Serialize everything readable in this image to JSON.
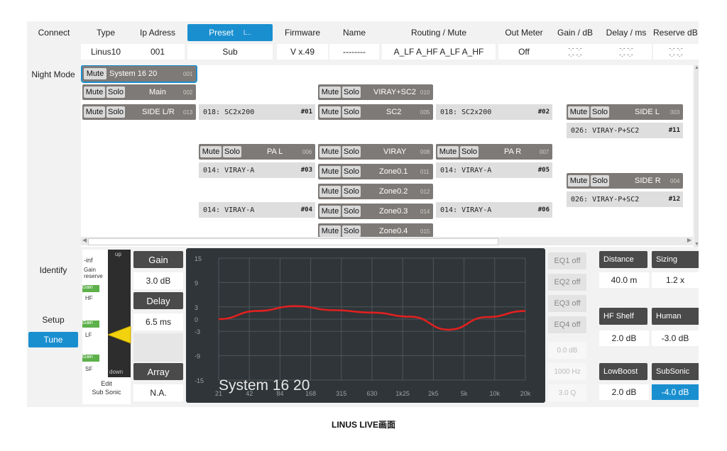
{
  "header": {
    "connect": "Connect",
    "type": "Type",
    "ip": "Ip Adress",
    "preset": "Preset",
    "preset_suffix": "L..",
    "firmware": "Firmware",
    "name": "Name",
    "routing": "Routing / Mute",
    "out_meter": "Out Meter",
    "gain": "Gain / dB",
    "delay": "Delay / ms",
    "reserve": "Reserve dB"
  },
  "device": {
    "type": "Linus10",
    "ip": "001",
    "preset": "Sub",
    "firmware": "V x.49",
    "name": "--------",
    "routing": "A_LF  A_HF  A_LF  A_HF",
    "out_meter": "Off",
    "dash": "-.-  -.-"
  },
  "sidebar": {
    "night_mode": "Night Mode",
    "identify": "Identify",
    "setup": "Setup",
    "tune": "Tune"
  },
  "patch": {
    "mute": "Mute",
    "solo": "Solo",
    "groups": {
      "system": {
        "name": "System 16 20",
        "num": "001"
      },
      "main": {
        "name": "Main",
        "num": "002"
      },
      "side_lr": {
        "name": "SIDE L/R",
        "num": "013"
      },
      "viray_sc2": {
        "name": "VIRAY+SC2",
        "num": "010"
      },
      "sc2": {
        "name": "SC2",
        "num": "005"
      },
      "side_l": {
        "name": "SIDE L",
        "num": "003"
      },
      "pal": {
        "name": "PA L",
        "num": "006"
      },
      "viray": {
        "name": "VIRAY",
        "num": "008"
      },
      "par": {
        "name": "PA R",
        "num": "007"
      },
      "zone1": {
        "name": "Zone0.1",
        "num": "011"
      },
      "zone2": {
        "name": "Zone0.2",
        "num": "012"
      },
      "zone3": {
        "name": "Zone0.3",
        "num": "014"
      },
      "zone4": {
        "name": "Zone0.4",
        "num": "015"
      },
      "side_r": {
        "name": "SIDE R",
        "num": "004"
      }
    },
    "subs": {
      "s01": {
        "name": "018: SC2x200",
        "num": "#01"
      },
      "s02": {
        "name": "018: SC2x200",
        "num": "#02"
      },
      "s11": {
        "name": "026: VIRAY-P+SC2",
        "num": "#11"
      },
      "s03": {
        "name": "014: VIRAY-A",
        "num": "#03"
      },
      "s05": {
        "name": "014: VIRAY-A",
        "num": "#05"
      },
      "s12": {
        "name": "026: VIRAY-P+SC2",
        "num": "#12"
      },
      "s04": {
        "name": "014: VIRAY-A",
        "num": "#04"
      },
      "s06": {
        "name": "014: VIRAY-A",
        "num": "#06"
      }
    }
  },
  "meter": {
    "inf": "-inf",
    "gain_reserve": "Gain reserve",
    "up": "up",
    "down": "down",
    "gain_tag": "Gain",
    "hf": "HF",
    "lf": "LF",
    "sf": "SF",
    "edit": "Edit",
    "sub_sonic": "Sub Sonic"
  },
  "controls": {
    "gain_label": "Gain",
    "gain_value": "3.0 dB",
    "delay_label": "Delay",
    "delay_value": "6.5 ms",
    "array_label": "Array",
    "array_value": "N.A."
  },
  "eq": {
    "eq1": "EQ1 off",
    "eq2": "EQ2 off",
    "eq3": "EQ3 off",
    "eq4": "EQ4 off",
    "gain_val": "0.0 dB",
    "freq_val": "1000 Hz",
    "q_val": "3.0 Q"
  },
  "right": {
    "distance_label": "Distance",
    "distance_value": "40.0 m",
    "sizing_label": "Sizing",
    "sizing_value": "1.2 x",
    "hfshelf_label": "HF Shelf",
    "hfshelf_value": "2.0 dB",
    "human_label": "Human",
    "human_value": "-3.0 dB",
    "lowboost_label": "LowBoost",
    "lowboost_value": "2.0 dB",
    "subsonic_label": "SubSonic",
    "subsonic_value": "-4.0 dB"
  },
  "graph": {
    "title": "System 16 20",
    "y_ticks": [
      "15",
      "9",
      "3",
      "0",
      "-3",
      "-9",
      "-15"
    ],
    "x_ticks": [
      "21",
      "42",
      "84",
      "168",
      "315",
      "630",
      "1k25",
      "2k5",
      "5k",
      "10k",
      "20k"
    ],
    "curve_color": "#e02020",
    "curve_y": [
      0,
      2.0,
      3.2,
      2.2,
      1.6,
      0.6,
      -2.6,
      0.5,
      2.0
    ]
  },
  "caption": "LINUS LIVE画面"
}
